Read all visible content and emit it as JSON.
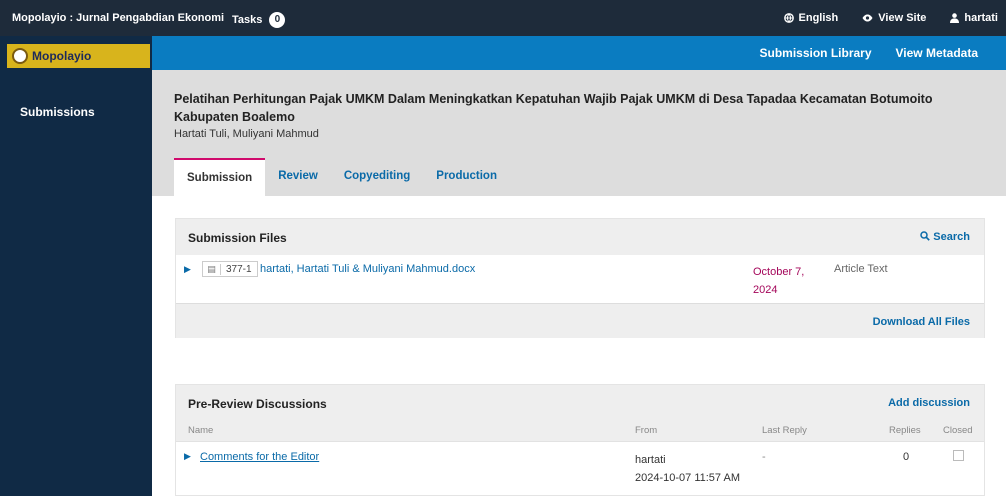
{
  "topbar": {
    "site_name": "Mopolayio : Jurnal Pengabdian Ekonomi",
    "tasks_label": "Tasks",
    "tasks_count": "0",
    "language": "English",
    "view_site": "View Site",
    "user": "hartati"
  },
  "sidebar": {
    "logo_text": "Mopolayio",
    "items": [
      {
        "label": "Submissions"
      }
    ]
  },
  "appbar": {
    "submission_library": "Submission Library",
    "view_metadata": "View Metadata"
  },
  "submission": {
    "title": "Pelatihan Perhitungan Pajak UMKM Dalam Meningkatkan Kepatuhan Wajib Pajak UMKM di Desa Tapadaa Kecamatan Botumoito Kabupaten Boalemo",
    "authors": "Hartati Tuli, Muliyani Mahmud"
  },
  "tabs": [
    {
      "label": "Submission",
      "active": true
    },
    {
      "label": "Review"
    },
    {
      "label": "Copyediting"
    },
    {
      "label": "Production"
    }
  ],
  "files_panel": {
    "title": "Submission Files",
    "search": "Search",
    "files": [
      {
        "id": "377-1",
        "name": "hartati, Hartati Tuli & Muliyani Mahmud.docx",
        "date_line1": "October 7,",
        "date_line2": "2024",
        "type": "Article Text"
      }
    ],
    "download_all": "Download All Files"
  },
  "discussions_panel": {
    "title": "Pre-Review Discussions",
    "add": "Add discussion",
    "columns": {
      "name": "Name",
      "from": "From",
      "last_reply": "Last Reply",
      "replies": "Replies",
      "closed": "Closed"
    },
    "rows": [
      {
        "name": "Comments for the Editor",
        "from_user": "hartati",
        "from_date": "2024-10-07 11:57 AM",
        "last_reply": "-",
        "replies": "0",
        "closed": false
      }
    ]
  },
  "colors": {
    "topbar": "#1e2b3a",
    "sidebar": "#102a45",
    "appbar": "#0a7cc1",
    "link": "#0a6aa8",
    "date": "#a4065a",
    "tab_accent": "#d00a6c",
    "logo": "#d8b41c"
  }
}
